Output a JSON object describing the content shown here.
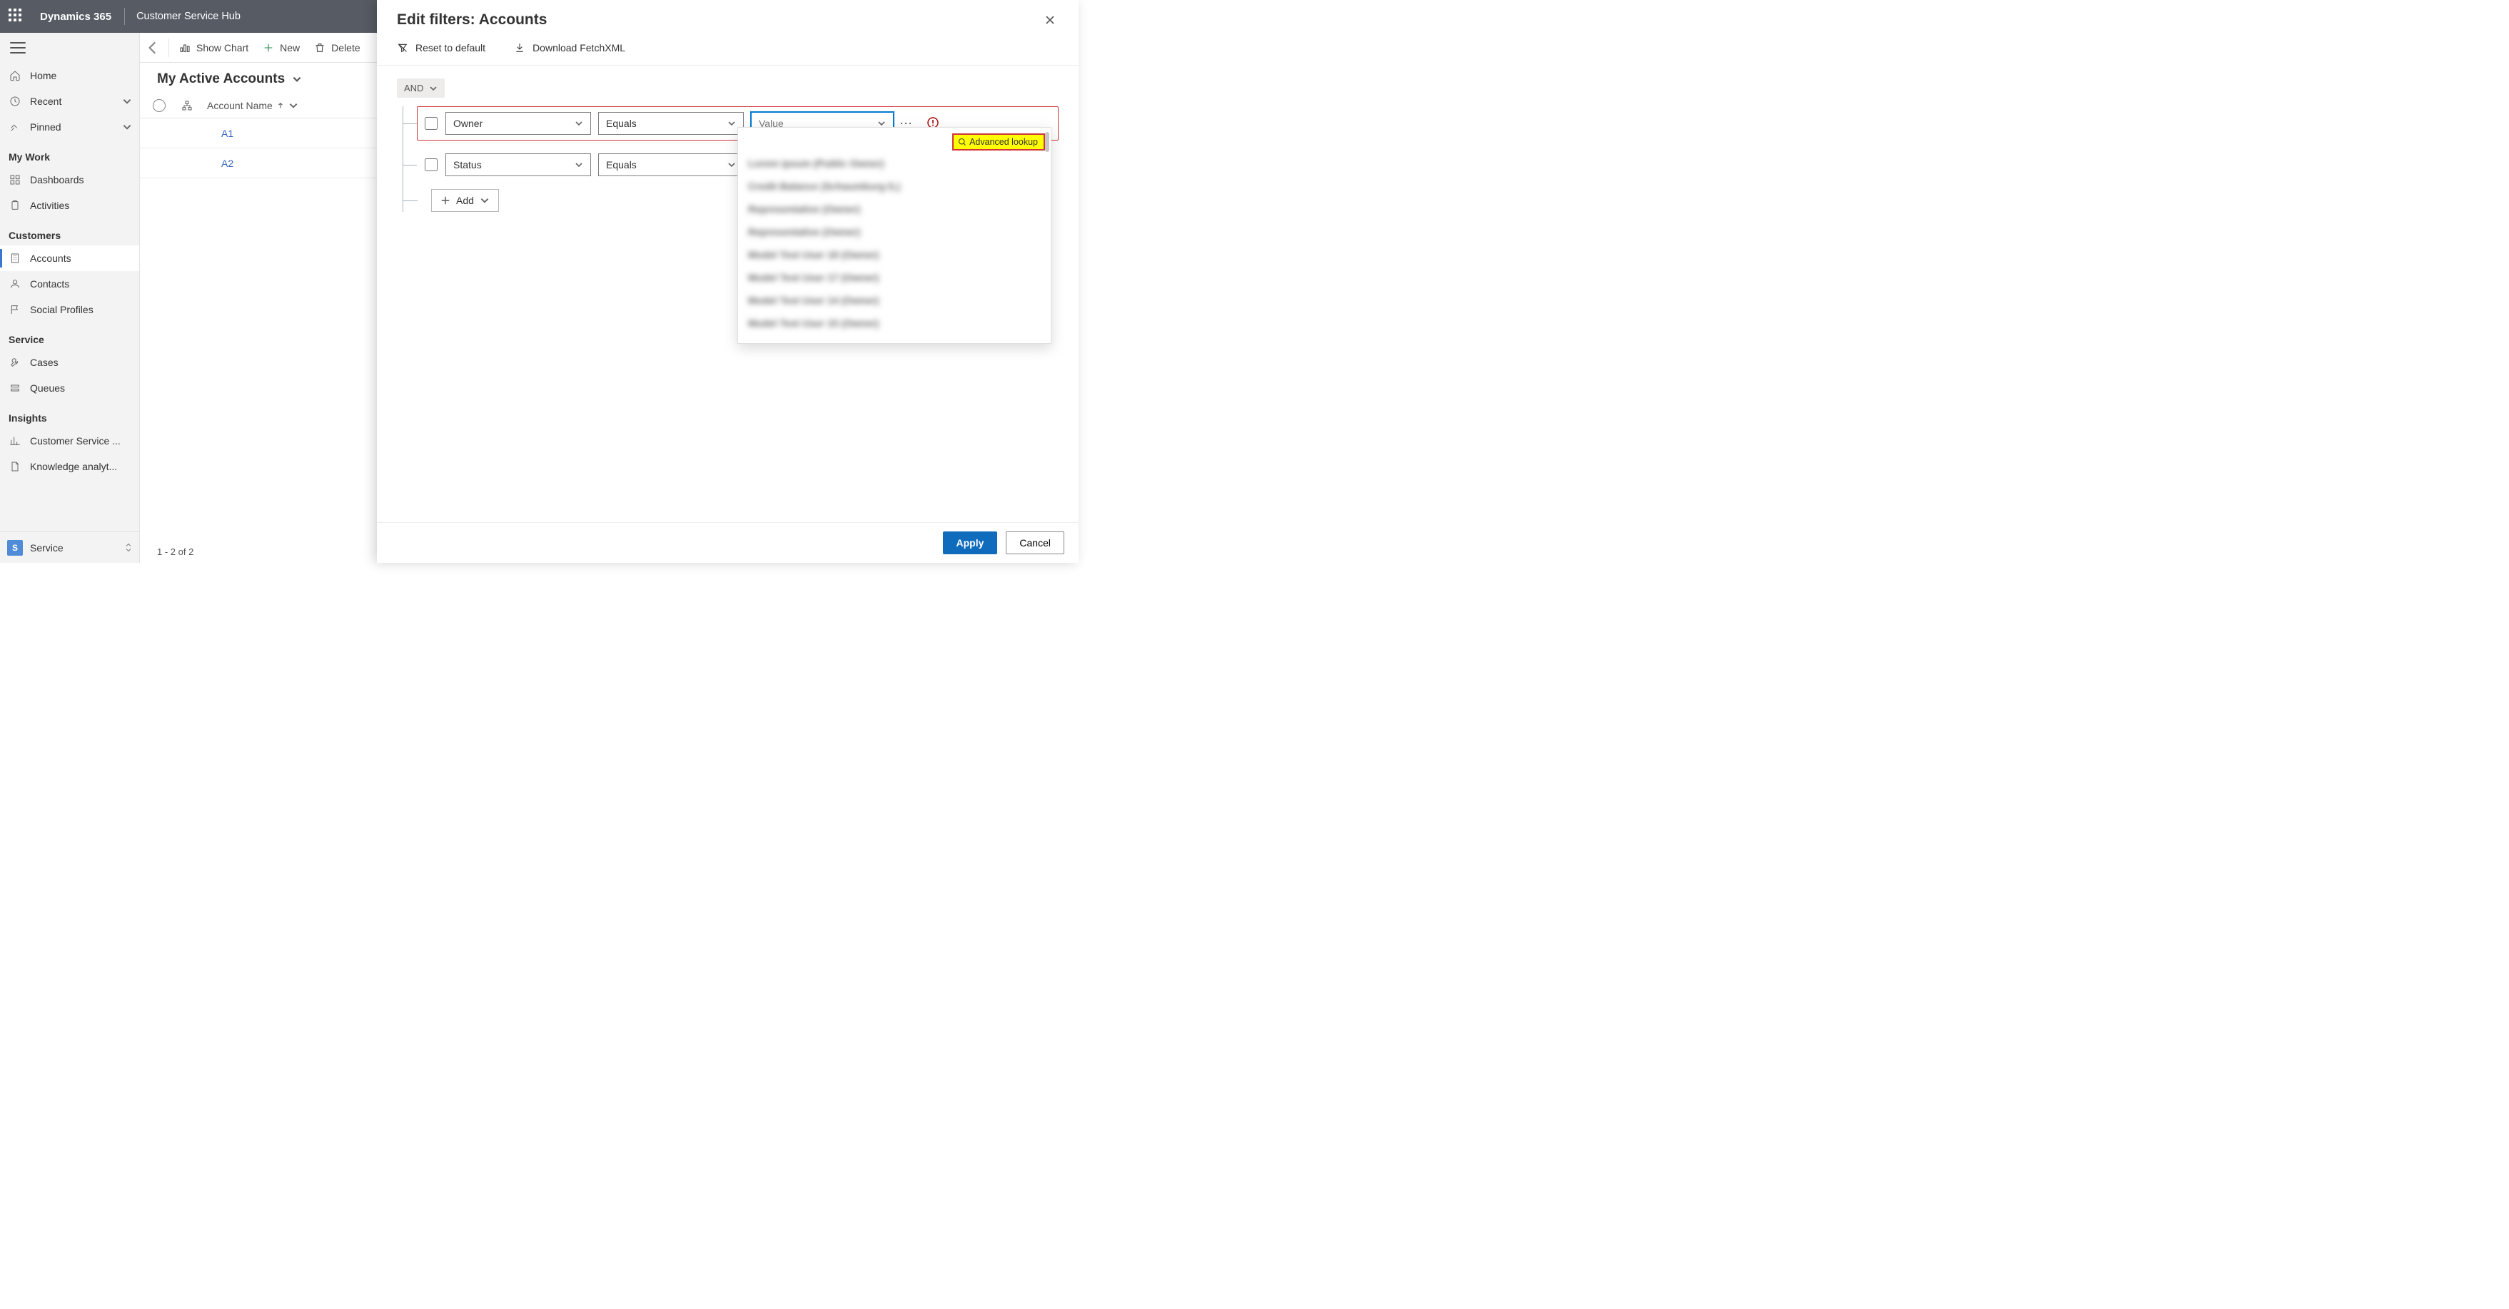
{
  "topnav": {
    "brand": "Dynamics 365",
    "hub": "Customer Service Hub"
  },
  "leftnav": {
    "top": [
      {
        "id": "home",
        "label": "Home",
        "icon": "home"
      },
      {
        "id": "recent",
        "label": "Recent",
        "icon": "clock",
        "expandable": true
      },
      {
        "id": "pinned",
        "label": "Pinned",
        "icon": "pin",
        "expandable": true
      }
    ],
    "sections": [
      {
        "title": "My Work",
        "items": [
          {
            "id": "dashboards",
            "label": "Dashboards",
            "icon": "dash"
          },
          {
            "id": "activities",
            "label": "Activities",
            "icon": "clip"
          }
        ]
      },
      {
        "title": "Customers",
        "items": [
          {
            "id": "accounts",
            "label": "Accounts",
            "icon": "building",
            "active": true
          },
          {
            "id": "contacts",
            "label": "Contacts",
            "icon": "person"
          },
          {
            "id": "social",
            "label": "Social Profiles",
            "icon": "flag"
          }
        ]
      },
      {
        "title": "Service",
        "items": [
          {
            "id": "cases",
            "label": "Cases",
            "icon": "wrench"
          },
          {
            "id": "queues",
            "label": "Queues",
            "icon": "queue"
          }
        ]
      },
      {
        "title": "Insights",
        "items": [
          {
            "id": "csperf",
            "label": "Customer Service ...",
            "icon": "chart"
          },
          {
            "id": "knowledge",
            "label": "Knowledge analyt...",
            "icon": "doc"
          }
        ]
      }
    ],
    "area": {
      "tile": "S",
      "label": "Service"
    }
  },
  "commandbar": {
    "showchart": "Show Chart",
    "new": "New",
    "delete": "Delete"
  },
  "view": {
    "title": "My Active Accounts",
    "column": "Account Name",
    "rows": [
      {
        "name": "A1"
      },
      {
        "name": "A2"
      }
    ],
    "status": "1 - 2 of 2"
  },
  "panel": {
    "title": "Edit filters: Accounts",
    "reset": "Reset to default",
    "download": "Download FetchXML",
    "group_op": "AND",
    "conditions": [
      {
        "field": "Owner",
        "op": "Equals",
        "value": "Value",
        "invalid": true
      },
      {
        "field": "Status",
        "op": "Equals",
        "value": "",
        "invalid": false
      }
    ],
    "add": "Add",
    "advanced": "Advanced lookup",
    "footer": {
      "apply": "Apply",
      "cancel": "Cancel"
    }
  }
}
